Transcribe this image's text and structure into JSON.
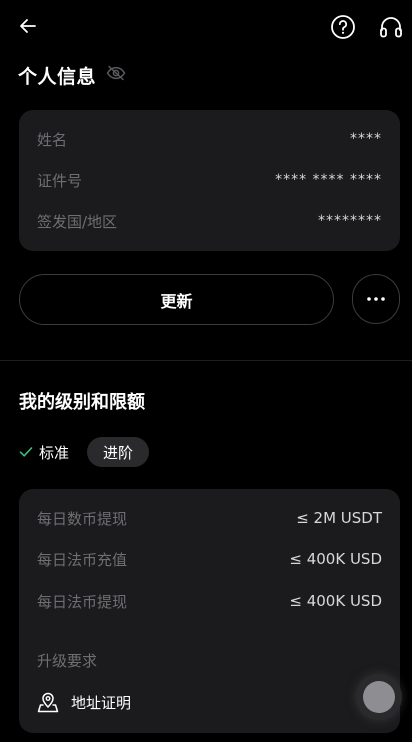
{
  "personal_info": {
    "title": "个人信息",
    "rows": [
      {
        "label": "姓名",
        "value": "****"
      },
      {
        "label": "证件号",
        "value": "**** **** ****"
      },
      {
        "label": "签发国/地区",
        "value": "********"
      }
    ],
    "update_label": "更新"
  },
  "levels": {
    "title": "我的级别和限额",
    "tab_standard": "标准",
    "tab_advanced": "进阶",
    "limits": [
      {
        "label": "每日数币提现",
        "value": "≤ 2M USDT"
      },
      {
        "label": "每日法币充值",
        "value": "≤ 400K USD"
      },
      {
        "label": "每日法币提现",
        "value": "≤ 400K USD"
      }
    ],
    "requirements_label": "升级要求",
    "requirement_item": "地址证明"
  },
  "icons": {
    "back": "arrow-left-icon",
    "help": "question-circle-icon",
    "support": "headset-icon",
    "hide": "eye-off-icon",
    "more": "ellipsis-icon",
    "check": "check-icon",
    "address": "map-pin-icon"
  },
  "colors": {
    "background": "#000000",
    "card": "#1b1b1d",
    "muted_text": "#6f6f73",
    "check": "#3ec07a"
  }
}
